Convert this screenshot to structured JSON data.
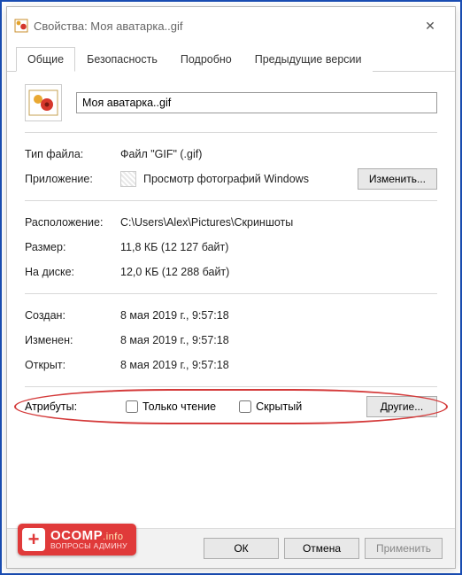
{
  "window": {
    "title": "Свойства: Моя аватарка..gif",
    "close": "✕"
  },
  "tabs": {
    "general": "Общие",
    "security": "Безопасность",
    "details": "Подробно",
    "previous": "Предыдущие версии"
  },
  "file": {
    "name": "Моя аватарка..gif",
    "type_label": "Тип файла:",
    "type_value": "Файл \"GIF\" (.gif)",
    "app_label": "Приложение:",
    "app_value": "Просмотр фотографий Windows",
    "change_btn": "Изменить...",
    "location_label": "Расположение:",
    "location_value": "C:\\Users\\Alex\\Pictures\\Скриншоты",
    "size_label": "Размер:",
    "size_value": "11,8 КБ (12 127 байт)",
    "disk_label": "На диске:",
    "disk_value": "12,0 КБ (12 288 байт)",
    "created_label": "Создан:",
    "created_value": "8 мая 2019 г., 9:57:18",
    "modified_label": "Изменен:",
    "modified_value": "8 мая 2019 г., 9:57:18",
    "accessed_label": "Открыт:",
    "accessed_value": "8 мая 2019 г., 9:57:18",
    "attr_label": "Атрибуты:",
    "readonly": "Только чтение",
    "hidden": "Скрытый",
    "advanced_btn": "Другие..."
  },
  "buttons": {
    "ok": "ОК",
    "cancel": "Отмена",
    "apply": "Применить"
  },
  "logo": {
    "brand": "OCOMP",
    "suffix": ".info",
    "slogan": "ВОПРОСЫ АДМИНУ"
  }
}
